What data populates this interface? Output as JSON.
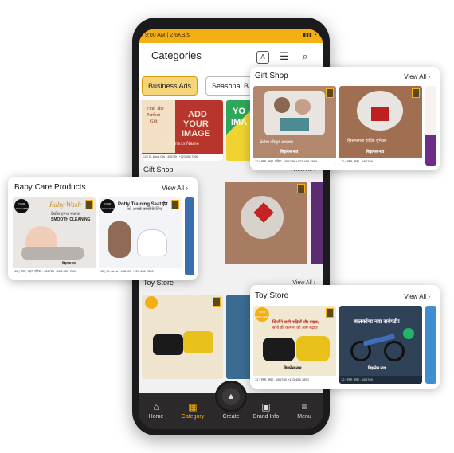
{
  "status": {
    "time": "9:00 AM",
    "speed": "2.6KB/s"
  },
  "appbar": {
    "title": "Categories"
  },
  "chips": [
    "Business Ads",
    "Seasonal B"
  ],
  "phone_sections": [
    {
      "title": "Gift Shop",
      "view_all": "View All"
    },
    {
      "title": "Toy Store",
      "view_all": "View All"
    }
  ],
  "phone_business_card": {
    "line1": "Find The",
    "line2": "Perfect",
    "line3": "Gift",
    "cta1": "ADD",
    "cta2": "YOUR",
    "cta3": "IMAGE",
    "name": "Business Name",
    "address": "12 | St, Area, City - 456789",
    "phone": "+123 456 7890"
  },
  "phone_second_card": {
    "text1": "YO",
    "text2": "IMA"
  },
  "bottom_nav": [
    "Home",
    "Category",
    "Create",
    "Brand Info",
    "Menu"
  ],
  "gift_popup": {
    "title": "Gift Shop",
    "view_all": "View All",
    "tile1": {
      "caption": "भेटीचा परिपूर्ण नजराणा.",
      "name": "बिझनेस नाव",
      "address": "12 | रस्ता, शहर, एरिया - 456789",
      "phone": "+123 456 7890"
    },
    "tile2": {
      "caption": "ख्रिसमसच्या हार्दिक शुभेच्छा",
      "name": "बिझनेस नाव",
      "address": "12 | रस्ता, शहर - 456789"
    }
  },
  "baby_popup": {
    "title": "Baby Care Products",
    "view_all": "View All",
    "tile1": {
      "logo": "YOUR LOGO HERE",
      "script": "Baby Wash",
      "hindi": "देखील हमथा बकाया",
      "label": "SMOOTH CLEANING",
      "name": "बिझनेस नाव",
      "address": "12 | रस्ता, शहर, एरिया - 456789",
      "phone": "+123 456 7890"
    },
    "tile2": {
      "logo": "YOUR LOGO HERE",
      "headline": "Potty Training Seat ईन",
      "sub": "को आपके बच्चों के लिए",
      "address": "12 | St, Area - 456789",
      "phone": "+123 456 7890"
    }
  },
  "toy_popup": {
    "title": "Toy Store",
    "view_all": "View All",
    "tile1": {
      "badge": "YOUR LOGO HERE",
      "headline": "खिलौने वाली गाड़ियाँ और बाइक,",
      "sub": "सभी की कल्पना को आगे बढ़ाए!",
      "name": "बिज़नेस नाम",
      "address": "12 | रस्ता, शहर - 456789",
      "phone": "+123 456 7890"
    },
    "tile2": {
      "headline": "बालकांचा नवा सवंगडी!",
      "name": "बिझनेस नाव",
      "address": "12 | रस्ता, शहर - 456789"
    }
  },
  "colors": {
    "accent": "#f2b015",
    "dark": "#2c292b"
  },
  "icons": [
    "translate-icon",
    "filter-icon",
    "search-icon",
    "home-icon",
    "category-icon",
    "image-icon",
    "briefcase-icon",
    "menu-icon",
    "bookmark-icon",
    "chevron-right-icon"
  ]
}
